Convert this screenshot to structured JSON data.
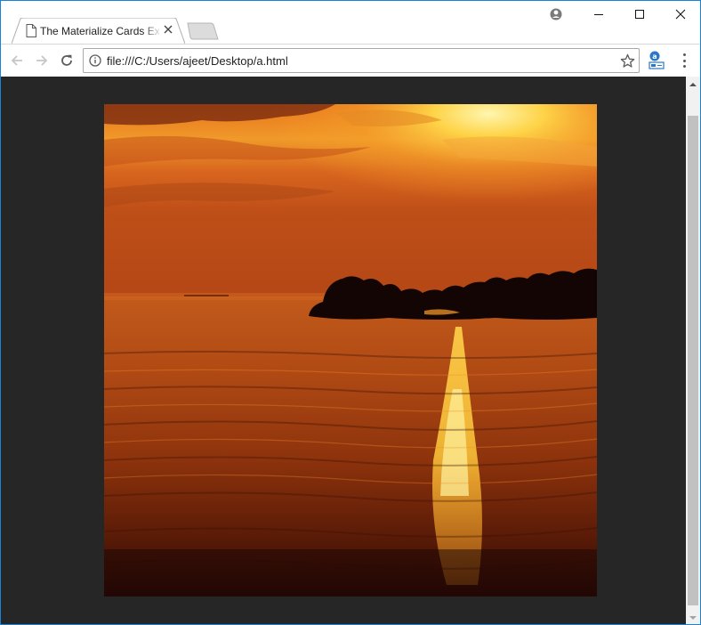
{
  "browser": {
    "tab": {
      "title": "The Materialize Cards Example",
      "icon": "page-icon",
      "close_icon": "close-icon"
    },
    "new_tab_icon": "new-tab-icon",
    "window_controls": {
      "profile_icon": "profile-icon",
      "minimize_icon": "minimize-icon",
      "maximize_icon": "maximize-icon",
      "close_icon": "close-icon"
    },
    "toolbar": {
      "back_icon": "back-arrow-icon",
      "forward_icon": "forward-arrow-icon",
      "reload_icon": "reload-icon",
      "info_icon": "info-icon",
      "url": "file:///C:/Users/ajeet/Desktop/a.html",
      "bookmark_icon": "star-icon",
      "extension_icon": "extension-icon",
      "menu_icon": "kebab-menu-icon"
    }
  },
  "page": {
    "background_color": "#262626",
    "image": {
      "subject": "sunset over water",
      "palette": [
        "#f7a21b",
        "#e0661a",
        "#a83a0d",
        "#3d1206",
        "#120303"
      ]
    }
  },
  "colors": {
    "window_border": "#1883d7",
    "scrollbar_track": "#f1f1f1",
    "scrollbar_thumb": "#c1c1c1"
  }
}
